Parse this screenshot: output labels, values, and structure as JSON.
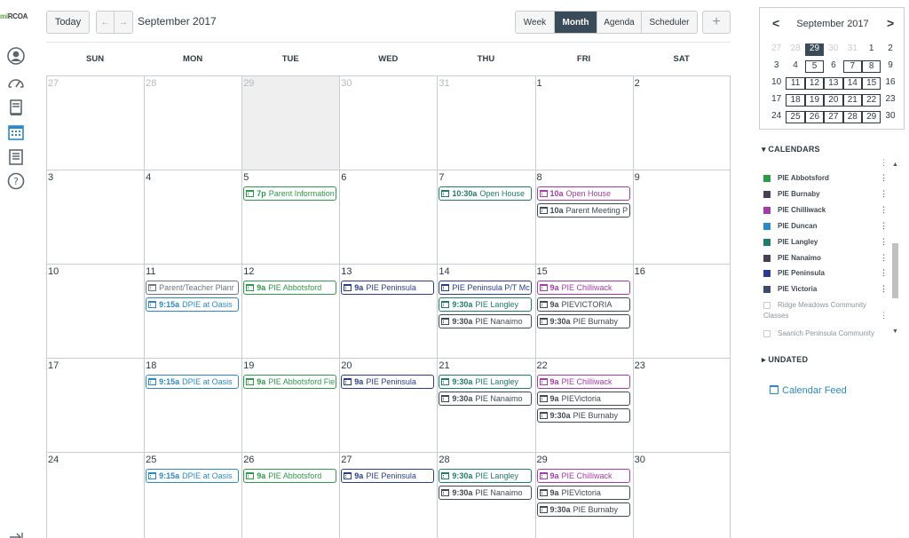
{
  "app": {
    "logo_prefix": "mi",
    "logo_suffix": "RCOA"
  },
  "toolbar": {
    "today_label": "Today",
    "prev_label": "←",
    "next_label": "→",
    "month_title": "September 2017",
    "views": [
      "Week",
      "Month",
      "Agenda",
      "Scheduler"
    ],
    "active_view": "Month",
    "add_label": "+"
  },
  "calendar": {
    "weekdays": [
      "SUN",
      "MON",
      "TUE",
      "WED",
      "THU",
      "FRI",
      "SAT"
    ],
    "weeks": [
      {
        "days": [
          {
            "n": "27",
            "other": true,
            "shade": false
          },
          {
            "n": "28",
            "other": true,
            "shade": false
          },
          {
            "n": "29",
            "other": true,
            "shade": true
          },
          {
            "n": "30",
            "other": true,
            "shade": false
          },
          {
            "n": "31",
            "other": true,
            "shade": false
          },
          {
            "n": "1",
            "other": false,
            "shade": false
          },
          {
            "n": "2",
            "other": false,
            "shade": false
          }
        ],
        "events": []
      },
      {
        "days": [
          {
            "n": "3"
          },
          {
            "n": "4"
          },
          {
            "n": "5"
          },
          {
            "n": "6"
          },
          {
            "n": "7"
          },
          {
            "n": "8"
          },
          {
            "n": "9"
          }
        ],
        "events": [
          {
            "day": 2,
            "slot": 0,
            "time": "7p",
            "title": "Parent Information",
            "color": "#2f9a4a"
          },
          {
            "day": 4,
            "slot": 0,
            "time": "10:30a",
            "title": "Open House",
            "color": "#1f7d6a"
          },
          {
            "day": 5,
            "slot": 0,
            "time": "10a",
            "title": "Open House",
            "color": "#a43ba8"
          },
          {
            "day": 5,
            "slot": 1,
            "time": "10a",
            "title": "Parent Meeting P",
            "color": "#3d4a52"
          }
        ]
      },
      {
        "days": [
          {
            "n": "10"
          },
          {
            "n": "11"
          },
          {
            "n": "12"
          },
          {
            "n": "13"
          },
          {
            "n": "14"
          },
          {
            "n": "15"
          },
          {
            "n": "16"
          }
        ],
        "events": [
          {
            "day": 1,
            "slot": 0,
            "time": "",
            "title": "Parent/Teacher Planr",
            "color": "#6b7780"
          },
          {
            "day": 1,
            "slot": 1,
            "time": "9:15a",
            "title": "DPIE at Oasis",
            "color": "#2b8ac6"
          },
          {
            "day": 2,
            "slot": 0,
            "time": "9a",
            "title": "PIE Abbotsford",
            "color": "#2f9a4a"
          },
          {
            "day": 3,
            "slot": 0,
            "time": "9a",
            "title": "PIE Peninsula",
            "color": "#2a3d8a"
          },
          {
            "day": 4,
            "slot": 0,
            "time": "",
            "title": "PIE Peninsula P/T Mc",
            "color": "#2a3d8a"
          },
          {
            "day": 4,
            "slot": 1,
            "time": "9:30a",
            "title": "PIE Langley",
            "color": "#1f7d6a"
          },
          {
            "day": 4,
            "slot": 2,
            "time": "9:30a",
            "title": "PIE Nanaimo",
            "color": "#3d4a52"
          },
          {
            "day": 5,
            "slot": 0,
            "time": "9a",
            "title": "PIE Chilliwack",
            "color": "#a43ba8"
          },
          {
            "day": 5,
            "slot": 1,
            "time": "9a",
            "title": "PIEVICTORIA",
            "color": "#3d4a52"
          },
          {
            "day": 5,
            "slot": 2,
            "time": "9:30a",
            "title": "PIE Burnaby",
            "color": "#3d4a52"
          }
        ]
      },
      {
        "days": [
          {
            "n": "17"
          },
          {
            "n": "18"
          },
          {
            "n": "19"
          },
          {
            "n": "20"
          },
          {
            "n": "21"
          },
          {
            "n": "22"
          },
          {
            "n": "23"
          }
        ],
        "events": [
          {
            "day": 1,
            "slot": 0,
            "time": "9:15a",
            "title": "DPIE at Oasis",
            "color": "#2b8ac6"
          },
          {
            "day": 2,
            "slot": 0,
            "time": "9a",
            "title": "PIE Abbotsford Fie",
            "color": "#2f9a4a"
          },
          {
            "day": 3,
            "slot": 0,
            "time": "9a",
            "title": "PIE Peninsula",
            "color": "#2a3d8a"
          },
          {
            "day": 4,
            "slot": 0,
            "time": "9:30a",
            "title": "PIE Langley",
            "color": "#1f7d6a"
          },
          {
            "day": 4,
            "slot": 1,
            "time": "9:30a",
            "title": "PIE Nanaimo",
            "color": "#3d4a52"
          },
          {
            "day": 5,
            "slot": 0,
            "time": "9a",
            "title": "PIE Chilliwack",
            "color": "#a43ba8"
          },
          {
            "day": 5,
            "slot": 1,
            "time": "9a",
            "title": "PIEVictoria",
            "color": "#3d4a52"
          },
          {
            "day": 5,
            "slot": 2,
            "time": "9:30a",
            "title": "PIE Burnaby",
            "color": "#3d4a52"
          }
        ]
      },
      {
        "days": [
          {
            "n": "24"
          },
          {
            "n": "25"
          },
          {
            "n": "26"
          },
          {
            "n": "27"
          },
          {
            "n": "28"
          },
          {
            "n": "29"
          },
          {
            "n": "30"
          }
        ],
        "events": [
          {
            "day": 1,
            "slot": 0,
            "time": "9:15a",
            "title": "DPIE at Oasis",
            "color": "#2b8ac6"
          },
          {
            "day": 2,
            "slot": 0,
            "time": "9a",
            "title": "PIE Abbotsford",
            "color": "#2f9a4a"
          },
          {
            "day": 3,
            "slot": 0,
            "time": "9a",
            "title": "PIE Peninsula",
            "color": "#2a3d8a"
          },
          {
            "day": 4,
            "slot": 0,
            "time": "9:30a",
            "title": "PIE Langley",
            "color": "#1f7d6a"
          },
          {
            "day": 4,
            "slot": 1,
            "time": "9:30a",
            "title": "PIE Nanaimo",
            "color": "#3d4a52"
          },
          {
            "day": 5,
            "slot": 0,
            "time": "9a",
            "title": "PIE Chilliwack",
            "color": "#a43ba8"
          },
          {
            "day": 5,
            "slot": 1,
            "time": "9a",
            "title": "PIEVictoria",
            "color": "#3d4a52"
          },
          {
            "day": 5,
            "slot": 2,
            "time": "9:30a",
            "title": "PIE Burnaby",
            "color": "#3d4a52"
          }
        ]
      }
    ]
  },
  "mini": {
    "title": "September 2017",
    "prev": "<",
    "next": ">",
    "rows": [
      [
        {
          "n": "27",
          "s": "other"
        },
        {
          "n": "28",
          "s": "other"
        },
        {
          "n": "29",
          "s": "today"
        },
        {
          "n": "30",
          "s": "other"
        },
        {
          "n": "31",
          "s": "other"
        },
        {
          "n": "1",
          "s": ""
        },
        {
          "n": "2",
          "s": ""
        }
      ],
      [
        {
          "n": "3",
          "s": ""
        },
        {
          "n": "4",
          "s": ""
        },
        {
          "n": "5",
          "s": "boxed"
        },
        {
          "n": "6",
          "s": ""
        },
        {
          "n": "7",
          "s": "boxed"
        },
        {
          "n": "8",
          "s": "boxed"
        },
        {
          "n": "9",
          "s": ""
        }
      ],
      [
        {
          "n": "10",
          "s": ""
        },
        {
          "n": "11",
          "s": "boxed"
        },
        {
          "n": "12",
          "s": "boxed"
        },
        {
          "n": "13",
          "s": "boxed"
        },
        {
          "n": "14",
          "s": "boxed"
        },
        {
          "n": "15",
          "s": "boxed"
        },
        {
          "n": "16",
          "s": ""
        }
      ],
      [
        {
          "n": "17",
          "s": ""
        },
        {
          "n": "18",
          "s": "boxed"
        },
        {
          "n": "19",
          "s": "boxed"
        },
        {
          "n": "20",
          "s": "boxed"
        },
        {
          "n": "21",
          "s": "boxed"
        },
        {
          "n": "22",
          "s": "boxed"
        },
        {
          "n": "23",
          "s": ""
        }
      ],
      [
        {
          "n": "24",
          "s": ""
        },
        {
          "n": "25",
          "s": "boxed"
        },
        {
          "n": "26",
          "s": "boxed"
        },
        {
          "n": "27",
          "s": "boxed"
        },
        {
          "n": "28",
          "s": "boxed"
        },
        {
          "n": "29",
          "s": "boxed"
        },
        {
          "n": "30",
          "s": ""
        }
      ]
    ]
  },
  "sidebar": {
    "calendars_label": "CALENDARS",
    "undated_label": "UNDATED",
    "feed_label": "Calendar Feed",
    "calendars": [
      {
        "name": "PIE Abbotsford",
        "color": "#2f9a4a"
      },
      {
        "name": "PIE Burnaby",
        "color": "#4a3d52"
      },
      {
        "name": "PIE Chilliwack",
        "color": "#a43ba8"
      },
      {
        "name": "PIE Duncan",
        "color": "#2b8ac6"
      },
      {
        "name": "PIE Langley",
        "color": "#1f7d6a"
      },
      {
        "name": "PIE Nanaimo",
        "color": "#4a3d52"
      },
      {
        "name": "PIE Peninsula",
        "color": "#2a3d8a"
      },
      {
        "name": "PIE Victoria",
        "color": "#3d4a6a"
      }
    ],
    "unchecked": [
      {
        "line1": "Ridge Meadows Community",
        "line2": "Classes"
      },
      {
        "line1": "Saanich Peninsula Community",
        "line2": ""
      }
    ]
  }
}
